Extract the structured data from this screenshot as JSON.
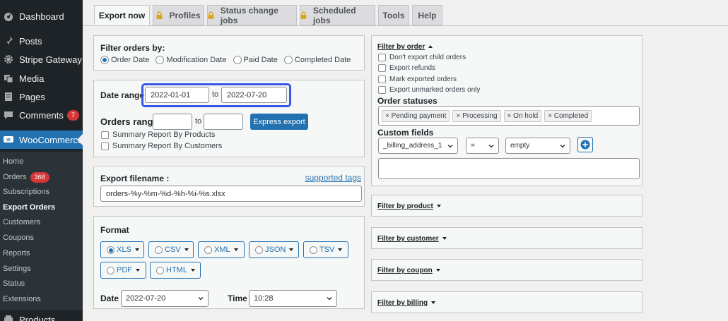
{
  "sidebar": {
    "top_items": [
      {
        "label": "Dashboard",
        "icon": "dashboard-icon"
      },
      {
        "label": "Posts",
        "icon": "pin-icon"
      },
      {
        "label": "Stripe Gateway",
        "icon": "gear-icon"
      },
      {
        "label": "Media",
        "icon": "media-icon"
      },
      {
        "label": "Pages",
        "icon": "pages-icon"
      },
      {
        "label": "Comments",
        "icon": "comment-icon",
        "badge": "7"
      },
      {
        "label": "WooCommerce",
        "icon": "woo-icon"
      }
    ],
    "submenu": [
      {
        "label": "Home"
      },
      {
        "label": "Orders",
        "badge": "368"
      },
      {
        "label": "Subscriptions"
      },
      {
        "label": "Export Orders"
      },
      {
        "label": "Customers"
      },
      {
        "label": "Coupons"
      },
      {
        "label": "Reports"
      },
      {
        "label": "Settings"
      },
      {
        "label": "Status"
      },
      {
        "label": "Extensions"
      }
    ],
    "bottom_item": {
      "label": "Products",
      "icon": "products-icon"
    }
  },
  "tabs": [
    "Export now",
    "Profiles",
    "Status change jobs",
    "Scheduled jobs",
    "Tools",
    "Help"
  ],
  "filter_orders": {
    "title": "Filter orders by:",
    "options": [
      "Order Date",
      "Modification Date",
      "Paid Date",
      "Completed Date"
    ],
    "selected": "Order Date"
  },
  "date_range": {
    "label": "Date range",
    "from": "2022-01-01",
    "to_label": "to",
    "to": "2022-07-20"
  },
  "orders_range": {
    "label": "Orders range",
    "from": "",
    "to_label": "to",
    "to": "",
    "express_button": "Express export",
    "summary_products": "Summary Report By Products",
    "summary_customers": "Summary Report By Customers"
  },
  "export_filename": {
    "label": "Export filename :",
    "link": "supported tags",
    "value": "orders-%y-%m-%d-%h-%i-%s.xlsx"
  },
  "format": {
    "title": "Format",
    "options": [
      "XLS",
      "CSV",
      "XML",
      "JSON",
      "TSV",
      "PDF",
      "HTML"
    ],
    "selected": "XLS"
  },
  "date_time": {
    "date_label": "Date",
    "date_value": "2022-07-20",
    "time_label": "Time",
    "time_value": "10:28"
  },
  "filter_by_order": {
    "title": "Filter by order",
    "checkboxes": [
      "Don't export child orders",
      "Export refunds",
      "Mark exported orders",
      "Export unmarked orders only"
    ],
    "statuses_label": "Order statuses",
    "statuses": [
      "× Pending payment",
      "× Processing",
      "× On hold",
      "× Completed"
    ],
    "custom_fields_label": "Custom fields",
    "custom_field": "_billing_address_1",
    "operator": "=",
    "value": "empty"
  },
  "collapsed_filters": [
    "Filter by product",
    "Filter by customer",
    "Filter by coupon",
    "Filter by billing"
  ],
  "colors": {
    "accent": "#2271b1",
    "sidebar": "#1d2327",
    "highlight": "#3858e9",
    "badge": "#d63638"
  }
}
